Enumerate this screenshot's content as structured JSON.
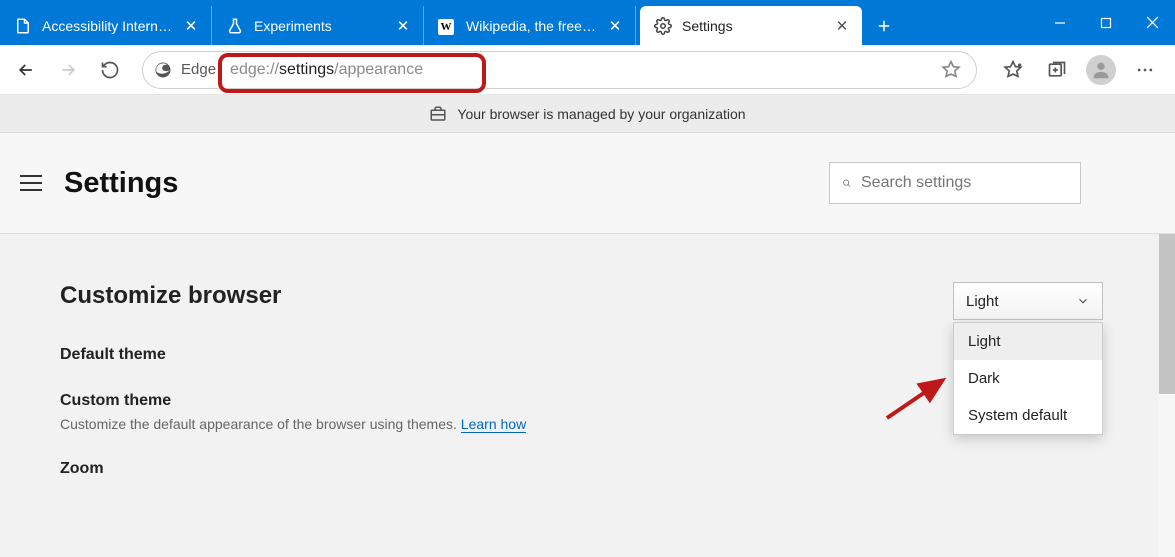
{
  "tabs": [
    {
      "label": "Accessibility Internals",
      "icon": "page-icon"
    },
    {
      "label": "Experiments",
      "icon": "flask-icon"
    },
    {
      "label": "Wikipedia, the free en",
      "icon": "wikipedia-icon"
    },
    {
      "label": "Settings",
      "icon": "gear-icon",
      "active": true
    }
  ],
  "toolbar": {
    "site_identity": "Edge",
    "url_scheme": "edge://",
    "url_dark": "settings",
    "url_rest": "/appearance"
  },
  "managed_banner": "Your browser is managed by your organization",
  "settings": {
    "title": "Settings",
    "search_placeholder": "Search settings",
    "section_title": "Customize browser",
    "theme_label": "Default theme",
    "theme_value": "Light",
    "theme_options": [
      "Light",
      "Dark",
      "System default"
    ],
    "custom_theme_label": "Custom theme",
    "custom_theme_sub": "Customize the default appearance of the browser using themes. ",
    "learn_how": "Learn how",
    "zoom_label": "Zoom"
  }
}
